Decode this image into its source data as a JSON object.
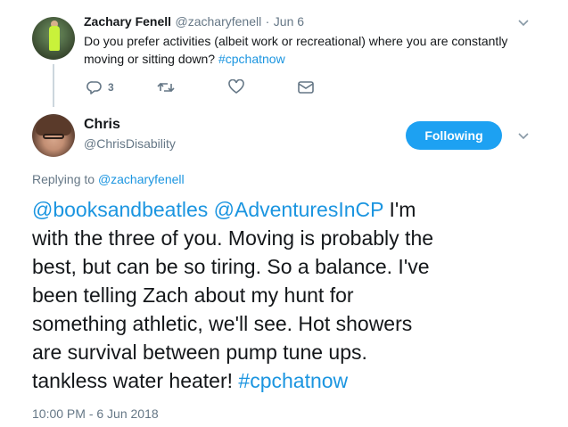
{
  "parent_tweet": {
    "name": "Zachary Fenell",
    "handle": "@zacharyfenell",
    "dot": "·",
    "date": "Jun 6",
    "text_line1": "Do you prefer activities (albeit work or recreational) where you are constantly",
    "text_line2_plain": "moving or sitting down? ",
    "hashtag": "#cpchatnow",
    "reply_count": "3",
    "icons": {
      "avatar": "zachary-avatar",
      "menu": "chevron-down-icon",
      "reply": "reply-icon",
      "retweet": "retweet-icon",
      "like": "heart-icon",
      "dm": "envelope-icon"
    }
  },
  "main_tweet": {
    "name": "Chris",
    "handle": "@ChrisDisability",
    "follow_label": "Following",
    "replying_prefix": "Replying to ",
    "replying_to": "@zacharyfenell",
    "mention1": "@booksandbeatles",
    "mention2": "@AdventuresInCP",
    "body_line1_rest": " I'm",
    "body_line2": "with the three of you. Moving is probably the",
    "body_line3": "best, but can be so tiring. So a balance. I've",
    "body_line4": "been telling Zach about my hunt for",
    "body_line5": "something athletic, we'll see. Hot showers",
    "body_line6": "are survival between pump tune ups.",
    "body_line7_plain": "tankless water heater! ",
    "hashtag": "#cpchatnow",
    "timestamp": "10:00 PM - 6 Jun 2018",
    "icons": {
      "avatar": "chris-avatar",
      "menu": "chevron-down-icon"
    }
  },
  "colors": {
    "link": "#1b95e0",
    "button": "#1da1f2",
    "muted": "#657786",
    "text": "#14171a"
  }
}
